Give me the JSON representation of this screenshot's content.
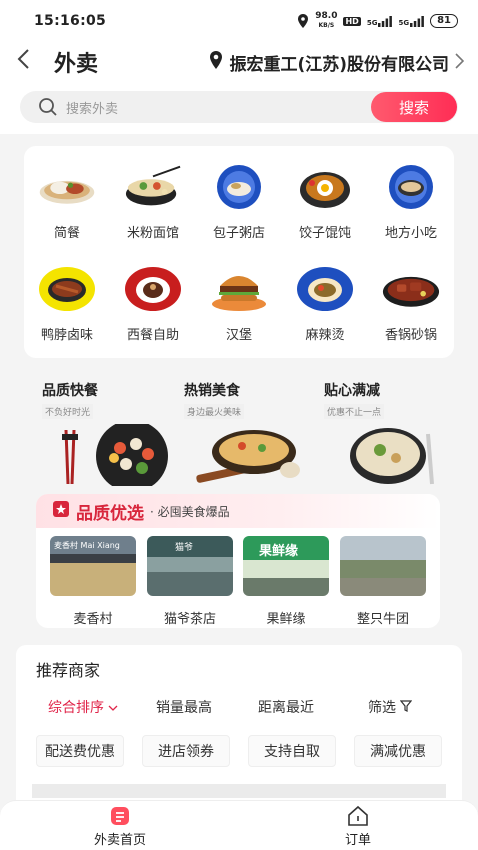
{
  "status": {
    "time": "15:16:05",
    "net_speed": "98.0",
    "net_unit": "KB/S",
    "hd": "HD",
    "sig1": "5G",
    "sig2": "5G",
    "battery": "81"
  },
  "header": {
    "back_icon": "chevron-left-icon",
    "title": "外卖",
    "location": "振宏重工(江苏)股份有限公司"
  },
  "search": {
    "placeholder": "搜索外卖",
    "button": "搜索"
  },
  "categories": [
    {
      "label": "简餐",
      "icon": "rice-dish-icon"
    },
    {
      "label": "米粉面馆",
      "icon": "noodle-bowl-icon"
    },
    {
      "label": "包子粥店",
      "icon": "bun-porridge-icon"
    },
    {
      "label": "饺子馄饨",
      "icon": "dumpling-icon"
    },
    {
      "label": "地方小吃",
      "icon": "local-snack-icon"
    },
    {
      "label": "鸭脖卤味",
      "icon": "braised-duck-icon"
    },
    {
      "label": "西餐自助",
      "icon": "western-buffet-icon"
    },
    {
      "label": "汉堡",
      "icon": "burger-icon"
    },
    {
      "label": "麻辣烫",
      "icon": "spicy-hotpot-icon"
    },
    {
      "label": "香锅砂锅",
      "icon": "claypot-icon"
    }
  ],
  "promos": [
    {
      "title": "品质快餐",
      "sub": "不负好时光"
    },
    {
      "title": "热销美食",
      "sub": "身边最火美味"
    },
    {
      "title": "贴心满减",
      "sub": "优惠不止一点"
    }
  ],
  "quality": {
    "title": "品质优选",
    "sub": "· 必囤美食爆品",
    "stores": [
      {
        "name": "麦香村",
        "sign": "麦香村 Mai Xiang"
      },
      {
        "name": "猫爷茶店",
        "sign": "猫爷"
      },
      {
        "name": "果鲜缘",
        "sign": "果鲜缘"
      },
      {
        "name": "整只牛团",
        "sign": ""
      }
    ]
  },
  "recommend": {
    "title": "推荐商家",
    "sorts": [
      "综合排序",
      "销量最高",
      "距离最近",
      "筛选"
    ],
    "filters": [
      "配送费优惠",
      "进店领券",
      "支持自取",
      "满减优惠"
    ]
  },
  "tabs": [
    {
      "label": "外卖首页",
      "icon": "takeout-home-icon"
    },
    {
      "label": "订单",
      "icon": "order-house-icon"
    }
  ],
  "colors": {
    "accent": "#e0254a",
    "search_button": "#ff2d55",
    "quality_title": "#d8263c"
  }
}
